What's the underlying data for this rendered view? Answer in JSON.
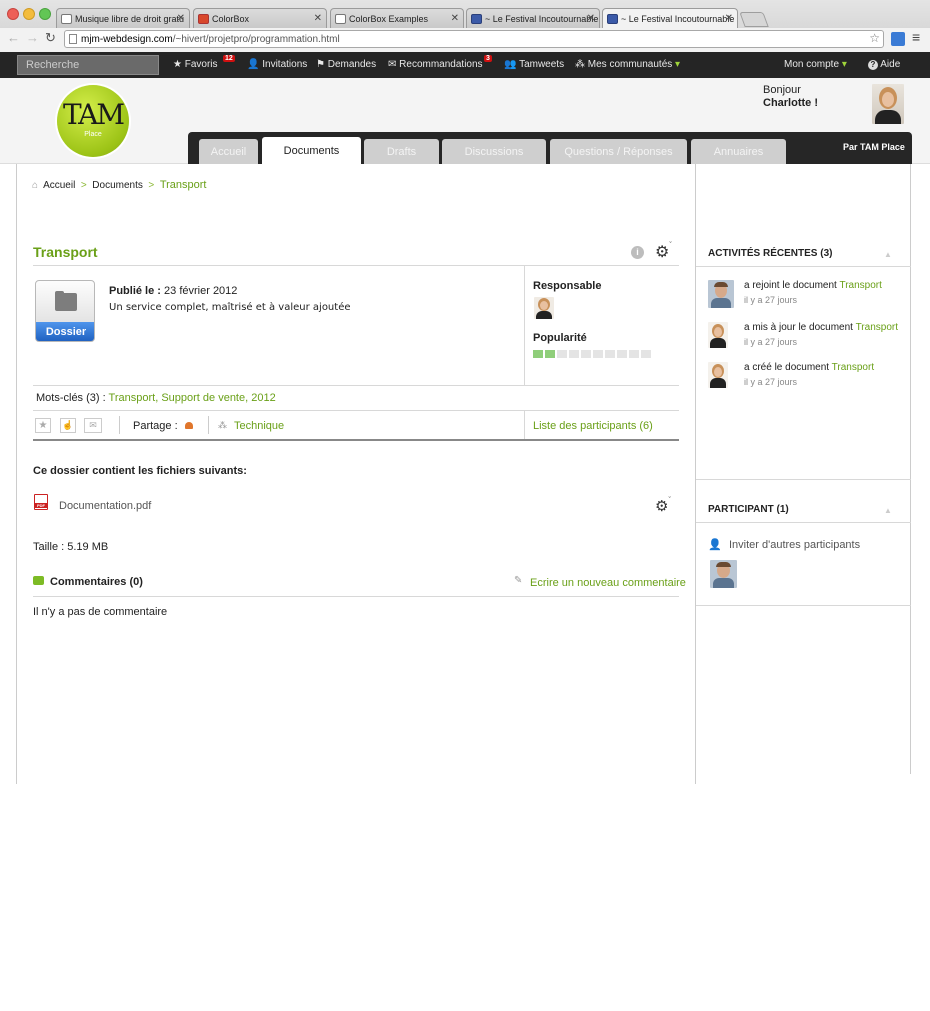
{
  "browser": {
    "tabs": [
      {
        "title": "Musique libre de droit gratu",
        "active": false
      },
      {
        "title": "ColorBox",
        "active": false
      },
      {
        "title": "ColorBox Examples",
        "active": false
      },
      {
        "title": "~ Le Festival Incoutournable",
        "active": false
      },
      {
        "title": "~ Le Festival Incoutournable",
        "active": true
      }
    ],
    "url_domain": "mjm-webdesign.com",
    "url_path": "/~hivert/projetpro/programmation.html"
  },
  "topmenu": {
    "search_placeholder": "Recherche",
    "items": [
      {
        "label": "Favoris",
        "badge": "12"
      },
      {
        "label": "Invitations",
        "badge": ""
      },
      {
        "label": "Demandes",
        "badge": ""
      },
      {
        "label": "Recommandations",
        "badge": "3"
      },
      {
        "label": "Tamweets",
        "badge": ""
      },
      {
        "label": "Mes communautés",
        "badge": ""
      }
    ],
    "account": "Mon compte",
    "help": "Aide"
  },
  "header": {
    "logo_text": "TAM",
    "logo_sub": "Place",
    "greeting": "Bonjour",
    "user_name": "Charlotte !",
    "brand": "Par TAM Place",
    "tabs": [
      "Accueil",
      "Documents",
      "Drafts",
      "Discussions",
      "Questions / Réponses",
      "Annuaires"
    ],
    "active_tab": "Documents"
  },
  "breadcrumb": [
    "Accueil",
    "Documents",
    "Transport"
  ],
  "document": {
    "title": "Transport",
    "folder_label": "Dossier",
    "published_label": "Publié le :",
    "published_date": "23 février 2012",
    "description": "Un service complet, maîtrisé et à valeur ajoutée",
    "responsable_label": "Responsable",
    "popularite_label": "Popularité",
    "popularity": 2,
    "popularity_max": 10,
    "keywords_label": "Mots-clés (3) :",
    "keywords": "Transport, Support de vente, 2012",
    "share_label": "Partage :",
    "category": "Technique",
    "participants_link": "Liste des participants (6)",
    "files_heading": "Ce dossier contient les fichiers suivants:",
    "file_name": "Documentation.pdf",
    "file_icon_text": "PDF",
    "size": "Taille : 5.19 MB",
    "comments_title": "Commentaires (0)",
    "write_comment": "Ecrire un nouveau commentaire",
    "no_comment": "Il n'y a pas de commentaire"
  },
  "sidebar": {
    "activities_title": "ACTIVITÉS RÉCENTES (3)",
    "activities": [
      {
        "action": "a rejoint le document",
        "target": "Transport",
        "time": "il y a 27 jours"
      },
      {
        "action": "a mis à jour le document",
        "target": "Transport",
        "time": "il y a 27 jours"
      },
      {
        "action": "a créé le document",
        "target": "Transport",
        "time": "il y a 27 jours"
      }
    ],
    "participants_title": "PARTICIPANT (1)",
    "invite": "Inviter d'autres participants"
  },
  "colors": {
    "accent": "#6aa018",
    "menubar": "#252525",
    "badge": "#d01010",
    "folder_button": "#2a6cc8"
  }
}
